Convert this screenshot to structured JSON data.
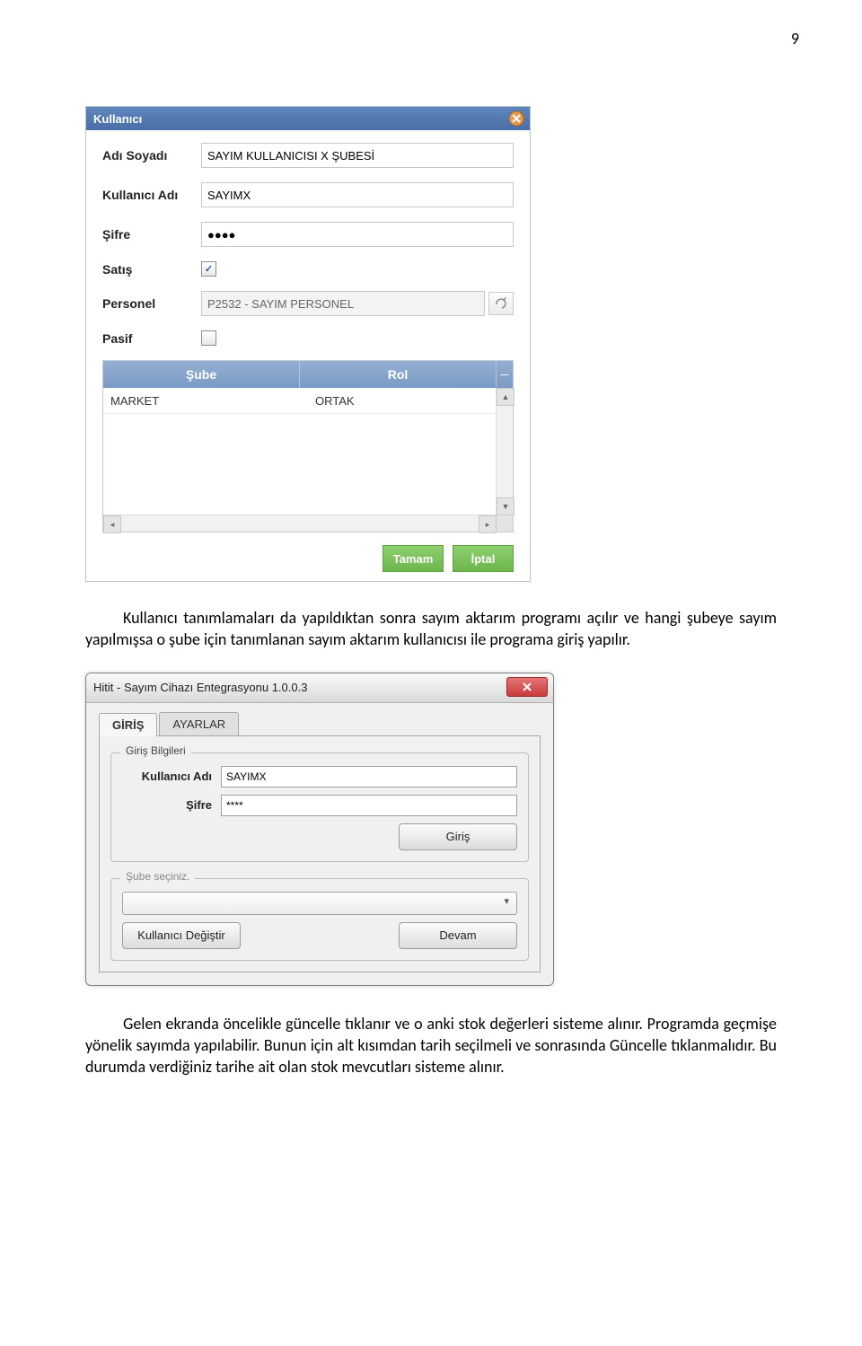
{
  "page_number": "9",
  "dialog1": {
    "title": "Kullanıcı",
    "labels": {
      "ad_soyad": "Adı Soyadı",
      "kullanici_adi": "Kullanıcı Adı",
      "sifre": "Şifre",
      "satis": "Satış",
      "personel": "Personel",
      "pasif": "Pasif"
    },
    "values": {
      "ad_soyad": "SAYIM KULLANICISI X ŞUBESİ",
      "kullanici_adi": "SAYIMX",
      "sifre": "●●●●",
      "personel": "P2532 - SAYIM PERSONEL",
      "satis_checked": "✓",
      "pasif_checked": ""
    },
    "grid": {
      "col_sube": "Şube",
      "col_rol": "Rol",
      "rows": [
        {
          "sube": "MARKET",
          "rol": "ORTAK"
        }
      ]
    },
    "actions": {
      "tamam": "Tamam",
      "iptal": "İptal"
    }
  },
  "para1": "Kullanıcı tanımlamaları da yapıldıktan sonra sayım aktarım programı açılır ve hangi şubeye sayım yapılmışsa o şube için tanımlanan sayım aktarım kullanıcısı ile programa giriş yapılır.",
  "dialog2": {
    "title": "Hitit - Sayım Cihazı Entegrasyonu 1.0.0.3",
    "tabs": {
      "giris": "GİRİŞ",
      "ayarlar": "AYARLAR"
    },
    "group1_title": "Giriş Bilgileri",
    "labels": {
      "kullanici_adi": "Kullanıcı Adı",
      "sifre": "Şifre"
    },
    "values": {
      "kullanici_adi": "SAYIMX",
      "sifre": "****"
    },
    "btn_giris": "Giriş",
    "group2_title": "Şube seçiniz.",
    "btn_degistir": "Kullanıcı Değiştir",
    "btn_devam": "Devam"
  },
  "para2": "Gelen ekranda öncelikle güncelle tıklanır ve o anki stok değerleri sisteme alınır. Programda geçmişe yönelik sayımda yapılabilir. Bunun için alt kısımdan tarih seçilmeli ve sonrasında Güncelle tıklanmalıdır. Bu durumda verdiğiniz tarihe ait olan stok mevcutları sisteme alınır."
}
